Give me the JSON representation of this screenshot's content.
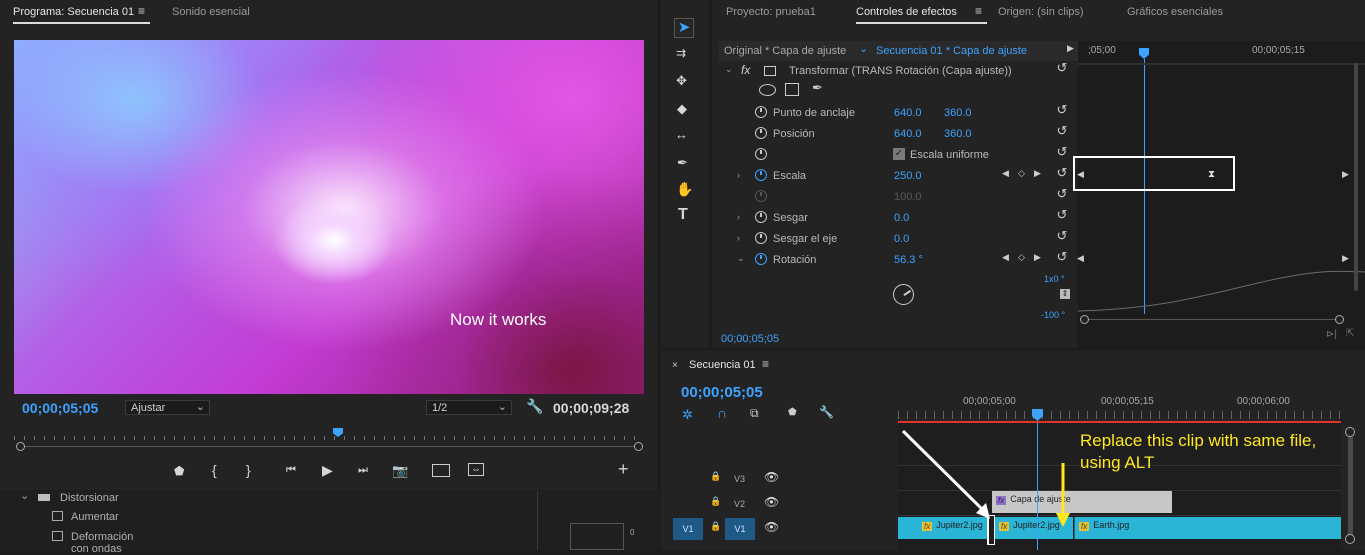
{
  "program": {
    "tab_active": "Programa: Secuencia 01",
    "tab_other": "Sonido esencial",
    "overlay_text": "Now it works",
    "timecode_current": "00;00;05;05",
    "fit_value": "Ajustar",
    "resolution": "1/2",
    "timecode_duration": "00;00;09;28"
  },
  "effects_browser": {
    "items": [
      "Distorsionar",
      "Aumentar",
      "Deformación con ondas"
    ]
  },
  "project_panel": {
    "tabs": [
      "Proyecto: prueba1",
      "Controles de efectos",
      "Origen: (sin clips)",
      "Gráficos esenciales"
    ],
    "source_label": "Original * Capa de ajuste",
    "sequence_label": "Secuencia 01 * Capa de ajuste",
    "effect_name": "Transformar (TRANS Rotación (Capa ajuste))",
    "fx_label": "fx",
    "props": {
      "anchor": {
        "label": "Punto de anclaje",
        "x": "640.0",
        "y": "360.0"
      },
      "position": {
        "label": "Posición",
        "x": "640.0",
        "y": "360.0"
      },
      "uniform": {
        "label": "Escala uniforme"
      },
      "scale": {
        "label": "Escala",
        "value": "250.0"
      },
      "scale_width": {
        "value": "100.0"
      },
      "skew": {
        "label": "Sesgar",
        "value": "0.0"
      },
      "skew_axis": {
        "label": "Sesgar el eje",
        "value": "0.0"
      },
      "rotation": {
        "label": "Rotación",
        "value": "56.3 °"
      }
    },
    "graph_top": "1x0 °",
    "graph_bottom": "-100 °",
    "ruler_left": ";05;00",
    "ruler_right": "00;00;05;15",
    "timecode": "00;00;05;05"
  },
  "timeline": {
    "title": "Secuencia 01",
    "timecode": "00;00;05;05",
    "ruler": [
      "00;00;05;00",
      "00;00;05;15",
      "00;00;06;00"
    ],
    "tracks": [
      {
        "label": "V3"
      },
      {
        "label": "V2"
      },
      {
        "label": "V1",
        "source": "V1"
      }
    ],
    "clips": {
      "adjust": "Capa de ajuste",
      "jup1": "Jupiter2.jpg",
      "jup2": "Jupiter2.jpg",
      "earth": "Earth.jpg"
    },
    "annotation": "Replace this clip with same file, using ALT",
    "meter_value": "0"
  },
  "colors": {
    "accent": "#2d8ceb",
    "clip_blue": "#2ab4d6",
    "annotation": "#ffe81f",
    "playhead": "#3ea2ff"
  }
}
